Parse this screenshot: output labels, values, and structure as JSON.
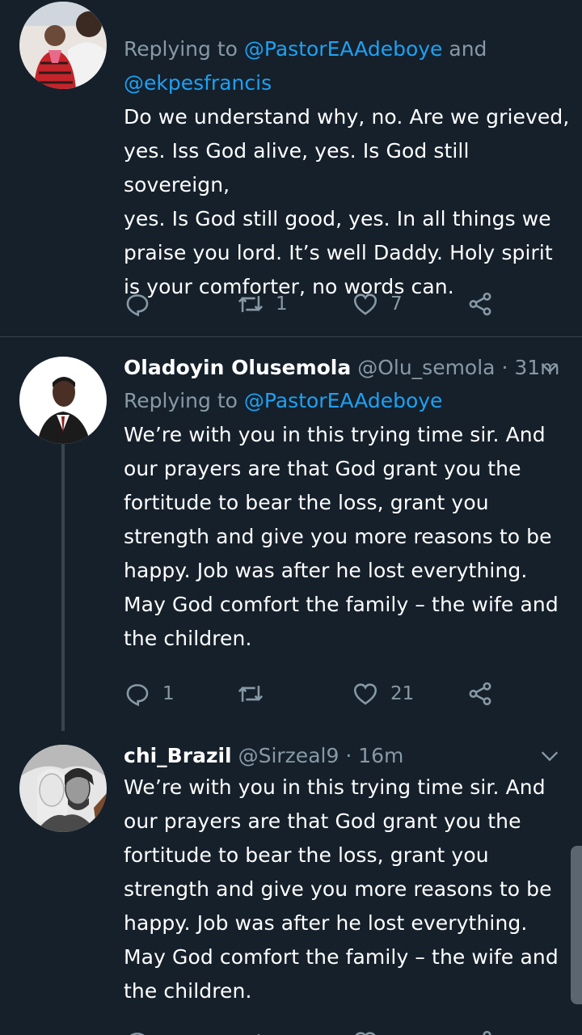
{
  "tweets": [
    {
      "reply_prefix": "Replying to ",
      "reply_mention_1": "@PastorEAAdeboye",
      "reply_and": " and",
      "reply_mention_2": "@ekpesfrancis",
      "body": "Do we understand why, no. Are we grieved,\nyes. Iss God alive, yes. Is God still sovereign,\nyes. Is God still good, yes. In all things we\npraise you lord. It’s well Daddy. Holy spirit\nis your comforter, no words can.",
      "replies": "",
      "retweets": "1",
      "likes": "7",
      "icons": [
        "reply-icon",
        "retweet-icon",
        "heart-icon",
        "share-icon"
      ]
    },
    {
      "name": "Oladoyin Olusemola",
      "handle": "@Olu_semola",
      "separator": " · ",
      "time": "31m",
      "reply_prefix": "Replying to ",
      "reply_mention_1": "@PastorEAAdeboye",
      "body": "We’re with you in this trying time sir. And\nour prayers are that God grant you the\nfortitude to bear the loss, grant you\nstrength and give you more reasons to be\nhappy. Job was after he lost everything.\nMay God comfort the family – the wife and\nthe children.",
      "replies": "1",
      "retweets": "",
      "likes": "21"
    },
    {
      "name": "chi_Brazil",
      "handle": "@Sirzeal9",
      "separator": " · ",
      "time": "16m",
      "body": "We’re with you in this trying time sir. And\nour prayers are that God grant you the\nfortitude to bear the loss, grant you\nstrength and give you more reasons to be\nhappy. Job was after he lost everything.\nMay God comfort the family – the wife and\nthe children."
    }
  ],
  "colors": {
    "background": "#15202b",
    "text": "#ffffff",
    "secondary": "#8899a6",
    "link": "#1da1f2",
    "divider": "#38444d"
  }
}
